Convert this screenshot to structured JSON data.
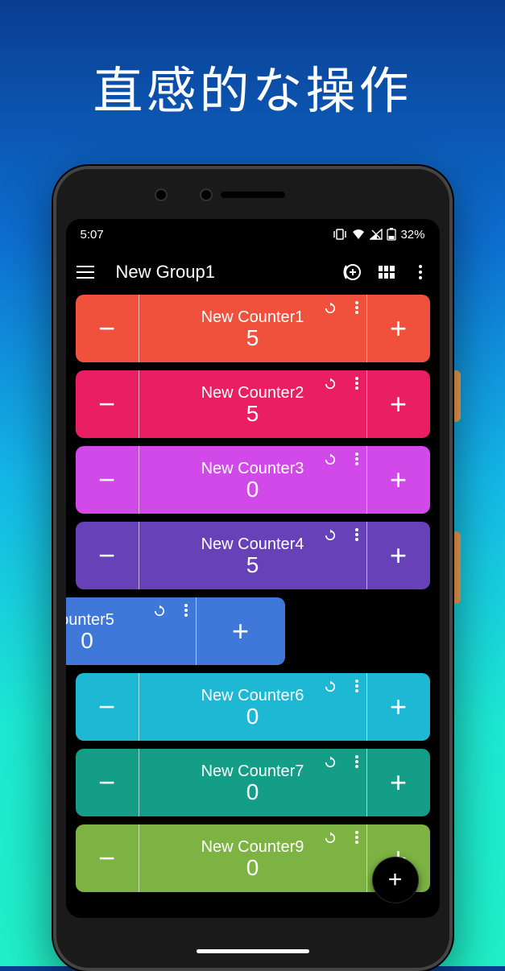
{
  "headline": "直感的な操作",
  "status": {
    "time": "5:07",
    "battery": "32%"
  },
  "app": {
    "title": "New Group1"
  },
  "counters": [
    {
      "name": "New Counter1",
      "value": "5",
      "color": "#f0513d",
      "swiped": false
    },
    {
      "name": "New Counter2",
      "value": "5",
      "color": "#e91e63",
      "swiped": false
    },
    {
      "name": "New Counter3",
      "value": "0",
      "color": "#d149e8",
      "swiped": false
    },
    {
      "name": "New Counter4",
      "value": "5",
      "color": "#6741b8",
      "swiped": false
    },
    {
      "name": "ounter5",
      "value": "0",
      "color": "#3f78d9",
      "swiped": true
    },
    {
      "name": "New Counter6",
      "value": "0",
      "color": "#1fb8d4",
      "swiped": false
    },
    {
      "name": "New Counter7",
      "value": "0",
      "color": "#159e87",
      "swiped": false
    },
    {
      "name": "New Counter9",
      "value": "0",
      "color": "#7cb342",
      "swiped": false
    }
  ],
  "fab_label": "+"
}
